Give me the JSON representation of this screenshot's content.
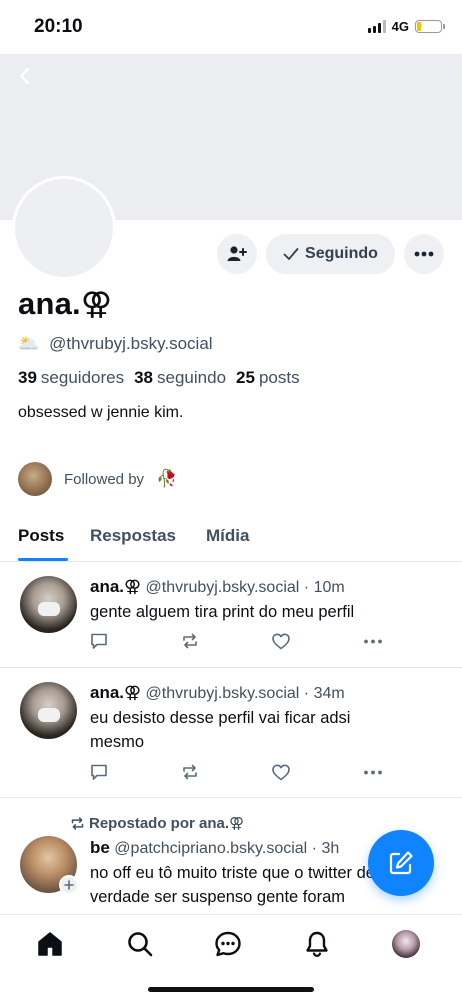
{
  "status_bar": {
    "time": "20:10",
    "network": "4G",
    "battery_level": 0.18
  },
  "profile": {
    "display_name": "ana.⚢",
    "handle_emoji": "🌥️",
    "handle": "@thvrubyj.bsky.social",
    "followers_count": "39",
    "followers_label": "seguidores",
    "following_count": "38",
    "following_label": "seguindo",
    "posts_count": "25",
    "posts_label": "posts",
    "bio": "obsessed w jennie kim.",
    "followed_by_label": "Followed by",
    "followed_by_emoji": "🥀",
    "following_button": "Seguindo"
  },
  "tabs": [
    {
      "label": "Posts"
    },
    {
      "label": "Respostas"
    },
    {
      "label": "Mídia"
    }
  ],
  "posts": [
    {
      "author": "ana.⚢",
      "handle": "@thvrubyj.bsky.social",
      "sep": "·",
      "time": "10m",
      "text": "gente alguem tira print do meu perfil"
    },
    {
      "author": "ana.⚢",
      "handle": "@thvrubyj.bsky.social",
      "sep": "·",
      "time": "34m",
      "text": "eu desisto desse perfil vai ficar adsi mesmo"
    },
    {
      "repost_label": "Repostado por ana.⚢",
      "author": "be",
      "handle": "@patchcipriano.bsky.social",
      "sep": "·",
      "time": "3h",
      "text": "no off eu tô muito triste que o twitter de verdade ser suspenso gente foram"
    }
  ],
  "colors": {
    "accent": "#1083fe",
    "banner": "#ecedf1",
    "muted_text": "#43505f"
  }
}
